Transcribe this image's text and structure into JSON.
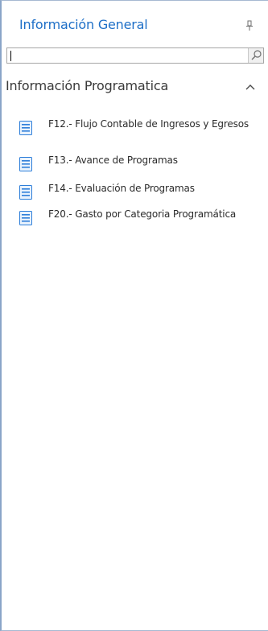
{
  "panel": {
    "title": "Información General",
    "pin_icon": "pin-icon"
  },
  "search": {
    "value": "",
    "placeholder": "",
    "button_icon": "search-icon"
  },
  "section": {
    "title": "Información Programatica",
    "toggle_icon": "chevron-up-icon"
  },
  "items": [
    {
      "label": "F12.- Flujo Contable de Ingresos y Egresos",
      "icon": "list-icon"
    },
    {
      "label": "F13.- Avance de Programas",
      "icon": "list-icon"
    },
    {
      "label": "F14.- Evaluación de Programas",
      "icon": "list-icon"
    },
    {
      "label": "F20.- Gasto por Categoria Programática",
      "icon": "list-icon"
    }
  ],
  "colors": {
    "title": "#1e6fc7",
    "icon_blue": "#2f7fd9",
    "border": "#a6b9d1"
  }
}
